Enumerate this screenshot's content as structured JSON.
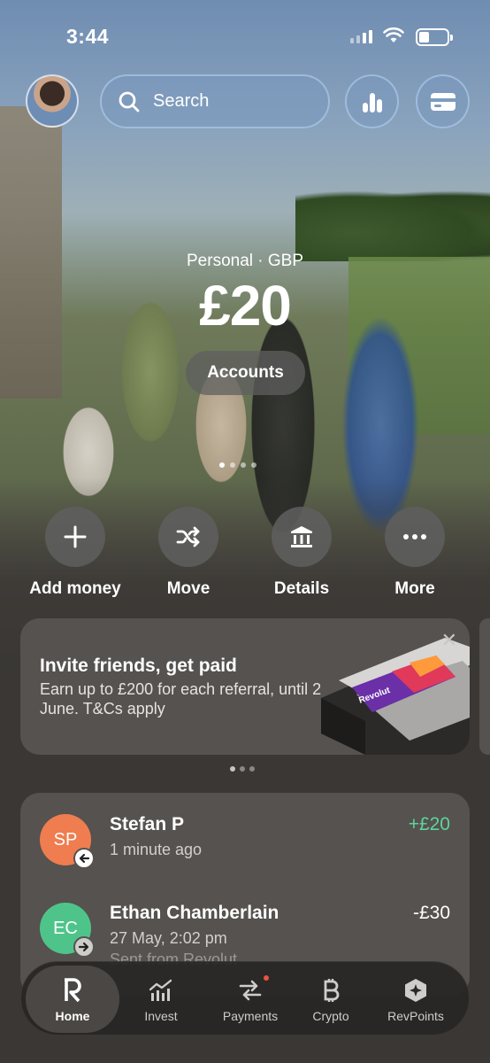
{
  "status_bar": {
    "time": "3:44"
  },
  "search": {
    "placeholder": "Search"
  },
  "account": {
    "label": "Personal · GBP",
    "balance": "£20",
    "accounts_button": "Accounts"
  },
  "actions": [
    {
      "label": "Add money",
      "icon": "plus-icon"
    },
    {
      "label": "Move",
      "icon": "shuffle-icon"
    },
    {
      "label": "Details",
      "icon": "bank-icon"
    },
    {
      "label": "More",
      "icon": "more-icon"
    }
  ],
  "promo": {
    "title": "Invite friends, get paid",
    "subtitle": "Earn up to £200 for each referral, until 2 June. T&Cs apply",
    "card_brand": "Revolut"
  },
  "transactions": [
    {
      "initials": "SP",
      "name": "Stefan P",
      "time": "1 minute ago",
      "amount": "+£20",
      "color": "#ef7d4f",
      "amount_color": "#5fd39b"
    },
    {
      "initials": "EC",
      "name": "Ethan Chamberlain",
      "time": "27 May, 2:02 pm",
      "subtitle": "Sent from Revolut",
      "amount": "-£30",
      "color": "#4fc48a",
      "amount_color": "#ffffff"
    }
  ],
  "tabs": [
    {
      "label": "Home",
      "icon": "revolut-r-icon",
      "active": true
    },
    {
      "label": "Invest",
      "icon": "invest-chart-icon"
    },
    {
      "label": "Payments",
      "icon": "payments-arrows-icon"
    },
    {
      "label": "Crypto",
      "icon": "bitcoin-icon"
    },
    {
      "label": "RevPoints",
      "icon": "revpoints-hexagon-icon"
    }
  ]
}
